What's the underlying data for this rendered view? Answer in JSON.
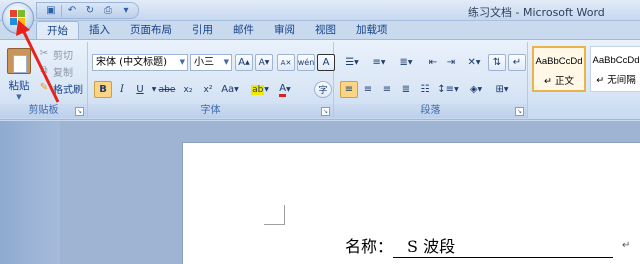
{
  "window": {
    "title": "练习文档 - Microsoft Word"
  },
  "quick_access": [
    {
      "icon": "save-icon",
      "glyph": "▣"
    },
    {
      "icon": "undo-icon",
      "glyph": "↶"
    },
    {
      "icon": "redo-icon",
      "glyph": "↻"
    },
    {
      "icon": "print-preview-icon",
      "glyph": "⎙"
    },
    {
      "icon": "customize-icon",
      "glyph": "▾"
    }
  ],
  "tabs": [
    "开始",
    "插入",
    "页面布局",
    "引用",
    "邮件",
    "审阅",
    "视图",
    "加载项"
  ],
  "active_tab": "开始",
  "clipboard": {
    "label": "剪贴板",
    "paste": "粘贴",
    "cut": "剪切",
    "copy": "复制",
    "format_painter": "格式刷"
  },
  "font": {
    "label": "字体",
    "font_name": "宋体 (中文标题)",
    "font_size": "小三",
    "grow": "A",
    "shrink": "A",
    "phonetic": "wén",
    "char_border": "A",
    "bold": "B",
    "italic": "I",
    "underline": "U",
    "strike": "abe",
    "subscript": "x₂",
    "superscript": "x²",
    "change_case": "Aa",
    "highlight": "ab",
    "font_color": "A",
    "char_shading": "字"
  },
  "paragraph": {
    "label": "段落"
  },
  "styles": [
    {
      "sample": "AaBbCcDd",
      "name": "↵ 正文",
      "selected": true
    },
    {
      "sample": "AaBbCcDd",
      "name": "↵ 无间隔",
      "selected": false
    }
  ],
  "document": {
    "label": "名称：",
    "value": "S 波段",
    "para_mark": "↵"
  },
  "colors": {
    "highlight_yellow": "#f5e800",
    "font_red": "#e02020",
    "annotation_red": "#e8221b"
  }
}
